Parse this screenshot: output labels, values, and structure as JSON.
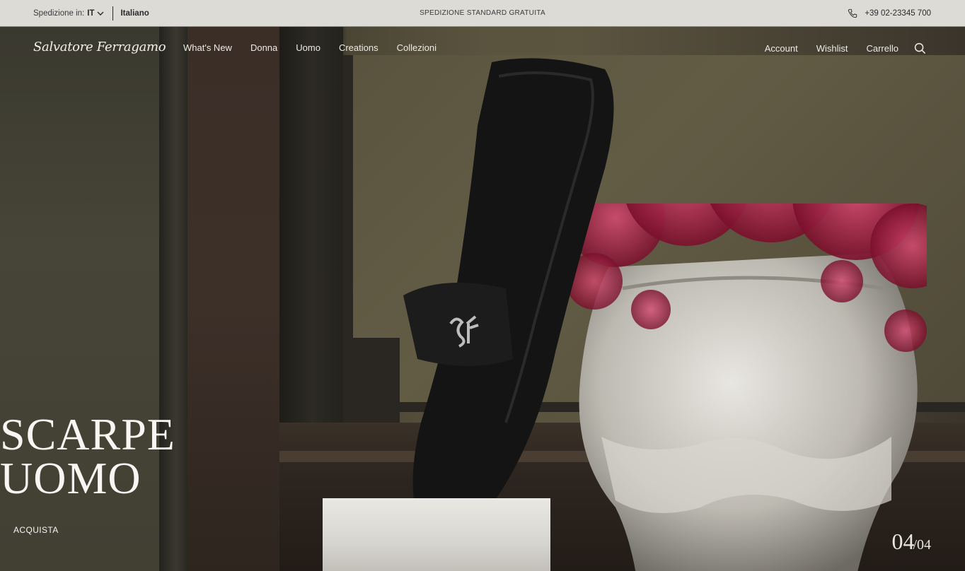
{
  "topbar": {
    "ship_label": "Spedizione in:",
    "ship_country": "IT",
    "language": "Italiano",
    "promo": "SPEDIZIONE STANDARD GRATUITA",
    "phone": "+39 02-23345 700"
  },
  "nav": {
    "logo": "Salvatore Ferragamo",
    "links": [
      "What's New",
      "Donna",
      "Uomo",
      "Creations",
      "Collezioni"
    ],
    "right": [
      "Account",
      "Wishlist",
      "Carrello"
    ]
  },
  "hero": {
    "headline_line1": "SCARPE",
    "headline_line2": "UOMO",
    "cta": "ACQUISTA",
    "pager_current": "04",
    "pager_separator": "/",
    "pager_total": "04"
  },
  "colors": {
    "topbar_bg": "#dcdbd6",
    "text_light": "#f7f6f2",
    "berries": "#b8244a"
  },
  "icons": [
    "chevron-down-icon",
    "phone-icon",
    "search-icon"
  ]
}
